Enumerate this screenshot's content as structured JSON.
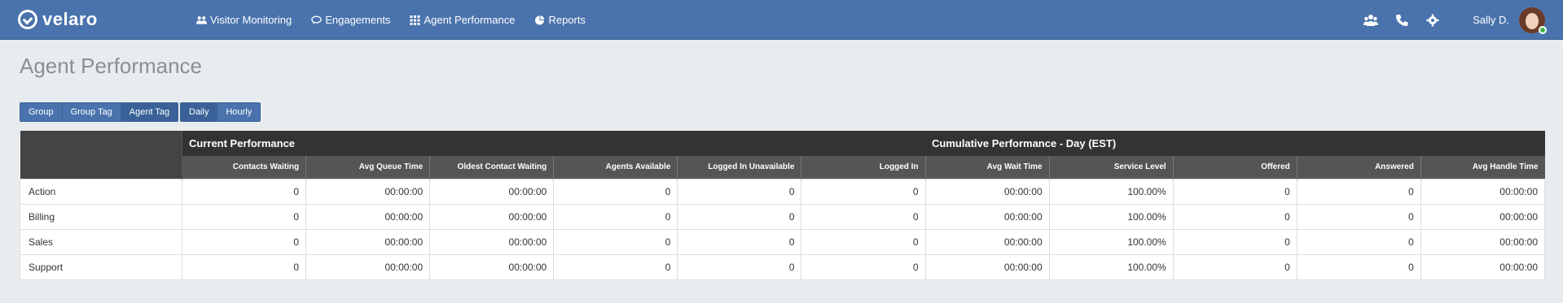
{
  "brand": {
    "name": "velaro"
  },
  "nav": {
    "items": [
      {
        "label": "Visitor Monitoring",
        "icon": "users-icon"
      },
      {
        "label": "Engagements",
        "icon": "chat-icon"
      },
      {
        "label": "Agent Performance",
        "icon": "grid-icon"
      },
      {
        "label": "Reports",
        "icon": "pie-chart-icon"
      }
    ]
  },
  "header_right": {
    "user_name": "Sally D.",
    "status_color": "#3cb54a"
  },
  "page": {
    "title": "Agent Performance"
  },
  "grouping": {
    "buttons": [
      "Group",
      "Group Tag",
      "Agent Tag"
    ],
    "active": "Agent Tag"
  },
  "interval": {
    "buttons": [
      "Daily",
      "Hourly"
    ],
    "active": "Daily"
  },
  "table": {
    "group_headers": {
      "current": "Current Performance",
      "cumulative": "Cumulative Performance - Day (EST)"
    },
    "columns": [
      "Contacts Waiting",
      "Avg Queue Time",
      "Oldest Contact Waiting",
      "Agents Available",
      "Logged In Unavailable",
      "Logged In",
      "Avg Wait Time",
      "Service Level",
      "Offered",
      "Answered",
      "Avg Handle Time"
    ],
    "rows": [
      {
        "label": "Action",
        "values": [
          "0",
          "00:00:00",
          "00:00:00",
          "0",
          "0",
          "0",
          "00:00:00",
          "100.00%",
          "0",
          "0",
          "00:00:00"
        ]
      },
      {
        "label": "Billing",
        "values": [
          "0",
          "00:00:00",
          "00:00:00",
          "0",
          "0",
          "0",
          "00:00:00",
          "100.00%",
          "0",
          "0",
          "00:00:00"
        ]
      },
      {
        "label": "Sales",
        "values": [
          "0",
          "00:00:00",
          "00:00:00",
          "0",
          "0",
          "0",
          "00:00:00",
          "100.00%",
          "0",
          "0",
          "00:00:00"
        ]
      },
      {
        "label": "Support",
        "values": [
          "0",
          "00:00:00",
          "00:00:00",
          "0",
          "0",
          "0",
          "00:00:00",
          "100.00%",
          "0",
          "0",
          "00:00:00"
        ]
      }
    ]
  },
  "colors": {
    "nav_bg": "#4a73ad",
    "table_header": "#333333",
    "subheader": "#555555"
  }
}
